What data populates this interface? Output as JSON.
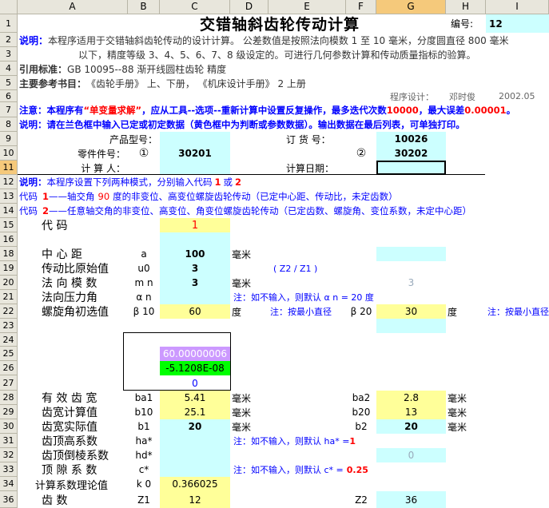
{
  "columns": [
    "A",
    "B",
    "C",
    "D",
    "E",
    "F",
    "G",
    "H",
    "I"
  ],
  "rows": [
    "1",
    "2",
    "3",
    "4",
    "5",
    "6",
    "7",
    "8",
    "9",
    "10",
    "11",
    "12",
    "13",
    "14",
    "15",
    "16",
    "18",
    "19",
    "20",
    "21",
    "22",
    "23",
    "24",
    "25",
    "26",
    "27",
    "28",
    "29",
    "30",
    "31",
    "32",
    "33",
    "34",
    "36",
    "37"
  ],
  "title": "交错轴斜齿轮传动计算",
  "id_label": "编号:",
  "id_value": "12",
  "desc_label": "说明：",
  "desc_line1": "本程序适用于交错轴斜齿轮传动的设计计算。 公差数值是按照法向模数 1 至 10 毫米，分度圆直径 800 毫米",
  "desc_line2": "以下，精度等级 3、4、5、6、7、8 级设定的。可进行几何参数计算和传动质量指标的验算。",
  "std_label": "引用标准：",
  "std_value": "GB 10095--88 渐开线圆柱齿轮 精度",
  "ref_label": "主要参考书目：",
  "ref_value": "《齿轮手册》 上、下册， 《机床设计手册》 2 上册",
  "designer_label": "程序设计：",
  "designer_name": "邓时俊",
  "designer_date": "2002.05",
  "note_label": "注意：",
  "note_text_a": "本程序有",
  "note_text_b": "“单变量求解”",
  "note_text_c": "，应从工具--选项--重新计算中设置反复操作，最多迭代次数",
  "note_iter": "10000",
  "note_text_d": "，最大误差",
  "note_err": "0.00001",
  "note_text_e": "。",
  "explain_label": "说明：",
  "explain_text": "请在兰色框中输入已定或初定数据（黄色框中为判断或参数数据）。输出数据在最后列表，可单独打印。",
  "product_type_label": "产品型号：",
  "order_no_label": "订 货 号：",
  "order_no_value": "10026",
  "part_no_label": "零件件号：",
  "circle1": "①",
  "part1": "30201",
  "circle2": "②",
  "part2": "30202",
  "calc_person_label": "计 算 人：",
  "calc_date_label": "计算日期：",
  "mode_label": "说明：",
  "mode_text_a": "本程序设置下列两种模式，分别输入代码",
  "mode_code1": "1",
  "mode_text_b": "或",
  "mode_code2": "2",
  "code1_label": "代码",
  "code1_num": "1",
  "code1_text_a": "——轴交角",
  "code1_angle": "90",
  "code1_text_b": "度的非变位、高变位螺旋齿轮传动（已定中心距、传动比，未定齿数）",
  "code2_label": "代码",
  "code2_num": "2",
  "code2_text": "——任意轴交角的非变位、高变位、角变位螺旋齿轮传动（已定齿数、螺旋角、变位系数，未定中心距）",
  "code_row_label": "代   码",
  "code_row_value": "1",
  "center_label": "中  心  距",
  "center_sym": "a",
  "center_val": "100",
  "unit_mm": "毫米",
  "ratio_label": "传动比原始值",
  "ratio_sym": "u0",
  "ratio_val": "3",
  "ratio_formula": "( Z2 / Z1 )",
  "module_label": "法 向 模 数",
  "module_sym": "m n",
  "module_val": "3",
  "module_g_val": "3",
  "pressure_label": "法向压力角",
  "pressure_sym": "α n",
  "pressure_note": "注：如不输入，则默认 α n = 20 度",
  "helix_label": "螺旋角初选值",
  "helix_sym1": "β 10",
  "helix_val1": "60",
  "unit_deg": "度",
  "helix_note": "注：按最小直径",
  "helix_sym2": "β 20",
  "helix_val2": "30",
  "helix_note2": "注：按最小直径",
  "purple_val": "60.00000006",
  "green_val": "-5.1208E-08",
  "zero_val": "0",
  "eff_width_label": "有 效 齿 宽",
  "eff_width_sym1": "ba1",
  "eff_width_val1": "5.41",
  "eff_width_sym2": "ba2",
  "eff_width_val2": "2.8",
  "calc_width_label": "齿宽计算值",
  "calc_width_sym1": "b10",
  "calc_width_val1": "25.1",
  "calc_width_sym2": "b20",
  "calc_width_val2": "13",
  "act_width_label": "齿宽实际值",
  "act_width_sym1": "b1",
  "act_width_val1": "20",
  "act_width_sym2": "b2",
  "act_width_val2": "20",
  "addendum_label": "齿顶高系数",
  "addendum_sym": "ha*",
  "addendum_note_a": "注：如不输入，则默认 ha* =",
  "addendum_note_b": "1",
  "chamfer_label": "齿顶倒棱系数",
  "chamfer_sym": "hd*",
  "chamfer_g_val": "0",
  "clearance_label": "顶 隙 系 数",
  "clearance_sym": "c*",
  "clearance_note_a": "注：如不输入，则默认 c* =",
  "clearance_note_b": "0.25",
  "k0_label": "计算系数理论值",
  "k0_sym": "k 0",
  "k0_val": "0.366025",
  "teeth_label": "齿       数",
  "teeth_sym1": "Z1",
  "teeth_val1": "12",
  "teeth_sym2": "Z2",
  "teeth_val2": "36"
}
